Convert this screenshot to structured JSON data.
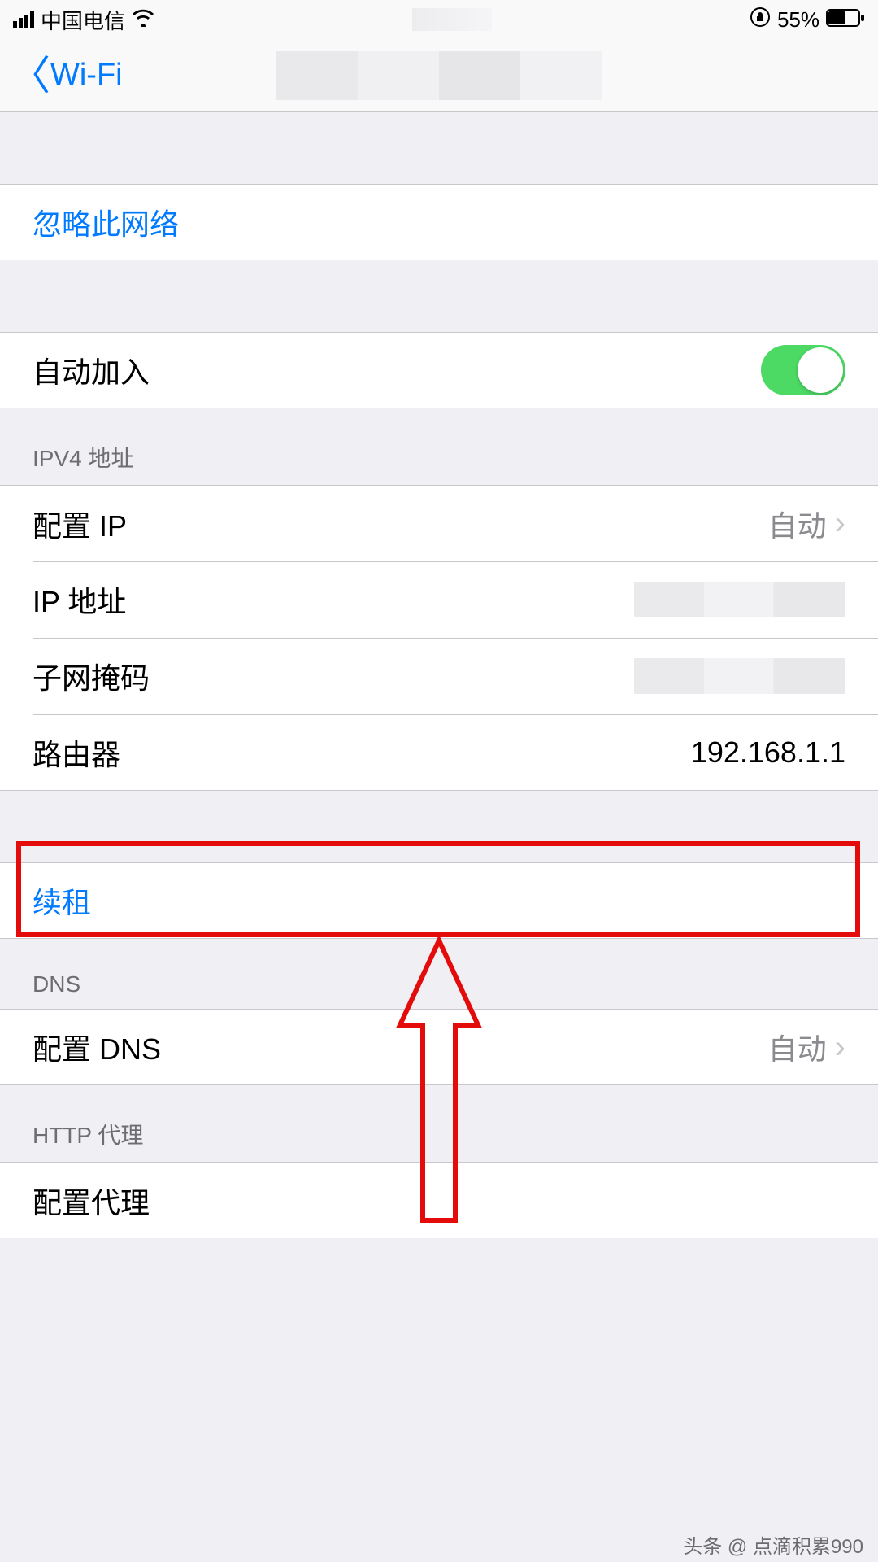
{
  "status": {
    "carrier": "中国电信",
    "battery_pct": "55%"
  },
  "nav": {
    "back_label": "Wi-Fi"
  },
  "forget": {
    "label": "忽略此网络"
  },
  "auto_join": {
    "label": "自动加入",
    "on": true
  },
  "ipv4": {
    "header": "IPV4 地址",
    "configure_ip_label": "配置 IP",
    "configure_ip_value": "自动",
    "ip_address_label": "IP 地址",
    "subnet_label": "子网掩码",
    "router_label": "路由器",
    "router_value": "192.168.1.1"
  },
  "renew": {
    "label": "续租"
  },
  "dns": {
    "header": "DNS",
    "configure_label": "配置 DNS",
    "configure_value": "自动"
  },
  "proxy": {
    "header": "HTTP 代理",
    "configure_label": "配置代理"
  },
  "watermark": "头条 @ 点滴积累990"
}
